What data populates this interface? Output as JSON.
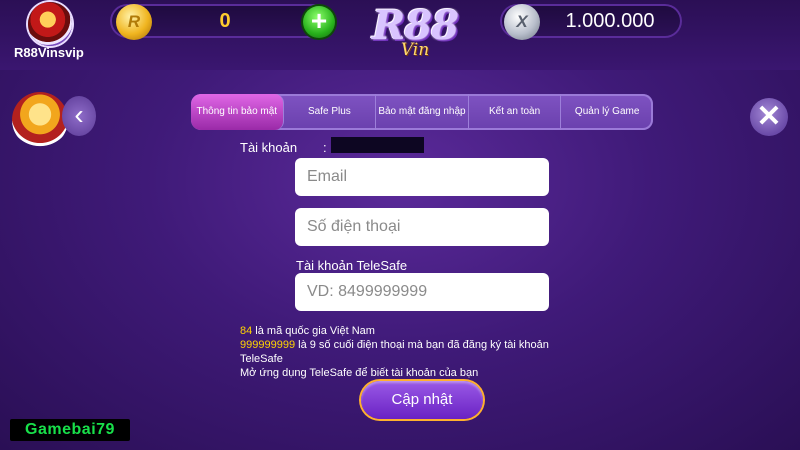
{
  "profile": {
    "username": "R88Vinsvip"
  },
  "currency": {
    "gold_coin_symbol": "R",
    "gold_balance": "0",
    "add_label": "+",
    "silver_coin_symbol": "X",
    "silver_balance": "1.000.000"
  },
  "logo": {
    "main": "R88",
    "sub": "Vin"
  },
  "nav": {
    "back_label": "‹",
    "close_label": "✕"
  },
  "tabs": [
    {
      "label": "Thông tin bảo mật",
      "active": true
    },
    {
      "label": "Safe Plus",
      "active": false
    },
    {
      "label": "Bảo mật đăng nhập",
      "active": false
    },
    {
      "label": "Kết an toàn",
      "active": false
    },
    {
      "label": "Quản lý Game",
      "active": false
    }
  ],
  "form": {
    "account_label": "Tài khoản",
    "account_colon": ":",
    "email_placeholder": "Email",
    "phone_placeholder": "Số điện thoại",
    "telesafe_label": "Tài khoản TeleSafe",
    "telesafe_placeholder": "VD: 8499999999"
  },
  "notes": {
    "line1_highlight": "84",
    "line1_text": " là mã quốc gia Việt Nam",
    "line2_highlight": "999999999",
    "line2_text": " là 9 số cuối điện thoại mà bạn đã đăng ký tài khoản TeleSafe",
    "line3_text": "Mở ứng dụng TeleSafe để biết tài khoản của bạn"
  },
  "actions": {
    "update_label": "Cập nhật"
  },
  "watermark": "Gamebai79",
  "colors": {
    "accent_gold": "#ffcc2e",
    "highlight": "#ffd400",
    "active_tab": "#d45ee0",
    "watermark": "#18e04a"
  }
}
